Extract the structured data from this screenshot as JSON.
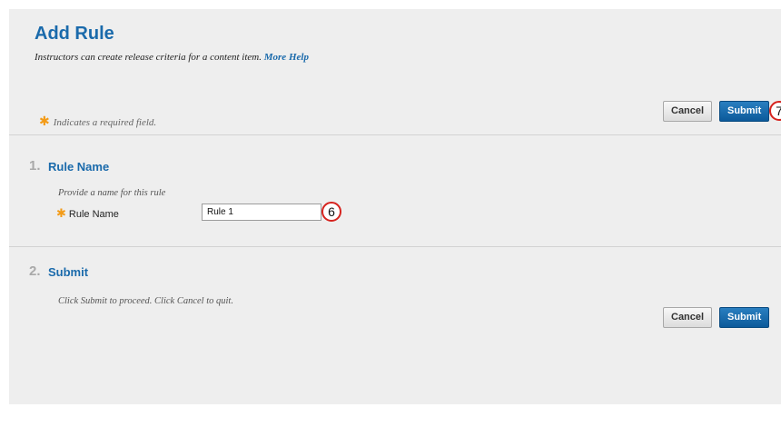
{
  "header": {
    "title": "Add Rule",
    "description": "Instructors can create release criteria for a content item.",
    "help_link": "More Help"
  },
  "required_note": {
    "icon": "asterisk-icon",
    "text": "Indicates a required field."
  },
  "top_actions": {
    "cancel_label": "Cancel",
    "submit_label": "Submit",
    "callout_number": "7"
  },
  "section1": {
    "number": "1.",
    "title": "Rule Name",
    "instruction": "Provide a name for this rule",
    "field_label": "Rule Name",
    "field_value": "Rule 1",
    "callout_number": "6"
  },
  "section2": {
    "number": "2.",
    "title": "Submit",
    "instruction": "Click Submit to proceed. Click Cancel to quit.",
    "cancel_label": "Cancel",
    "submit_label": "Submit"
  },
  "colors": {
    "accent": "#1a6aab",
    "required_star": "#f39b17",
    "callout_border": "#d6231e",
    "background": "#eeeeee"
  }
}
